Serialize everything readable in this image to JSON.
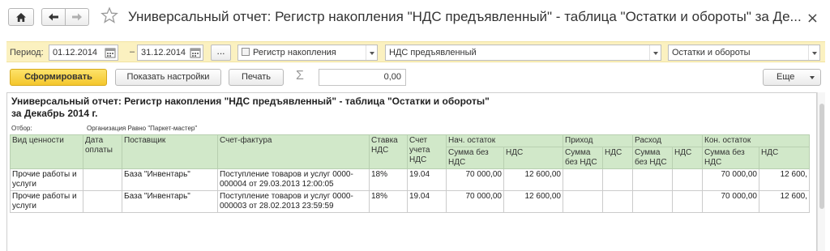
{
  "window": {
    "title": "Универсальный отчет: Регистр накопления \"НДС предъявленный\" - таблица \"Остатки и обороты\" за Де...",
    "close_glyph": "×"
  },
  "params": {
    "period_label": "Период:",
    "date_from": "01.12.2014",
    "dash": "–",
    "date_to": "31.12.2014",
    "dots_label": "...",
    "source_type": "Регистр накопления",
    "source_name": "НДС предъявленный",
    "table_type": "Остатки и обороты"
  },
  "toolbar": {
    "generate_label": "Сформировать",
    "settings_label": "Показать настройки",
    "print_label": "Печать",
    "sigma": "Σ",
    "sum_value": "0,00",
    "more_label": "Еще"
  },
  "report": {
    "title": "Универсальный отчет: Регистр накопления \"НДС предъявленный\" - таблица \"Остатки и обороты\" за Декабрь 2014 г.",
    "filter_label": "Отбор:",
    "filter_value": "Организация Равно \"Паркет-мастер\"",
    "headers": {
      "vid": "Вид ценности",
      "date": "Дата оплаты",
      "supplier": "Поставщик",
      "invoice": "Счет-фактура",
      "rate": "Ставка НДС",
      "account": "Счет учета НДС",
      "open_balance": "Нач. остаток",
      "receipt": "Приход",
      "expense": "Расход",
      "close_balance": "Кон. остаток",
      "sum_no_vat": "Сумма без НДС",
      "vat": "НДС"
    },
    "rows": [
      {
        "vid": "Прочие работы и услуги",
        "date": "",
        "supplier": "База \"Инвентарь\"",
        "invoice": "Поступление товаров и услуг 0000-000004 от 29.03.2013 12:00:05",
        "rate": "18%",
        "account": "19.04",
        "open_sum": "70 000,00",
        "open_vat": "12 600,00",
        "close_sum": "70 000,00",
        "close_vat": "12 600,"
      },
      {
        "vid": "Прочие работы и услуги",
        "date": "",
        "supplier": "База \"Инвентарь\"",
        "invoice": "Поступление товаров и услуг 0000-000003 от 28.02.2013 23:59:59",
        "rate": "18%",
        "account": "19.04",
        "open_sum": "70 000,00",
        "open_vat": "12 600,00",
        "close_sum": "70 000,00",
        "close_vat": "12 600,"
      }
    ]
  }
}
